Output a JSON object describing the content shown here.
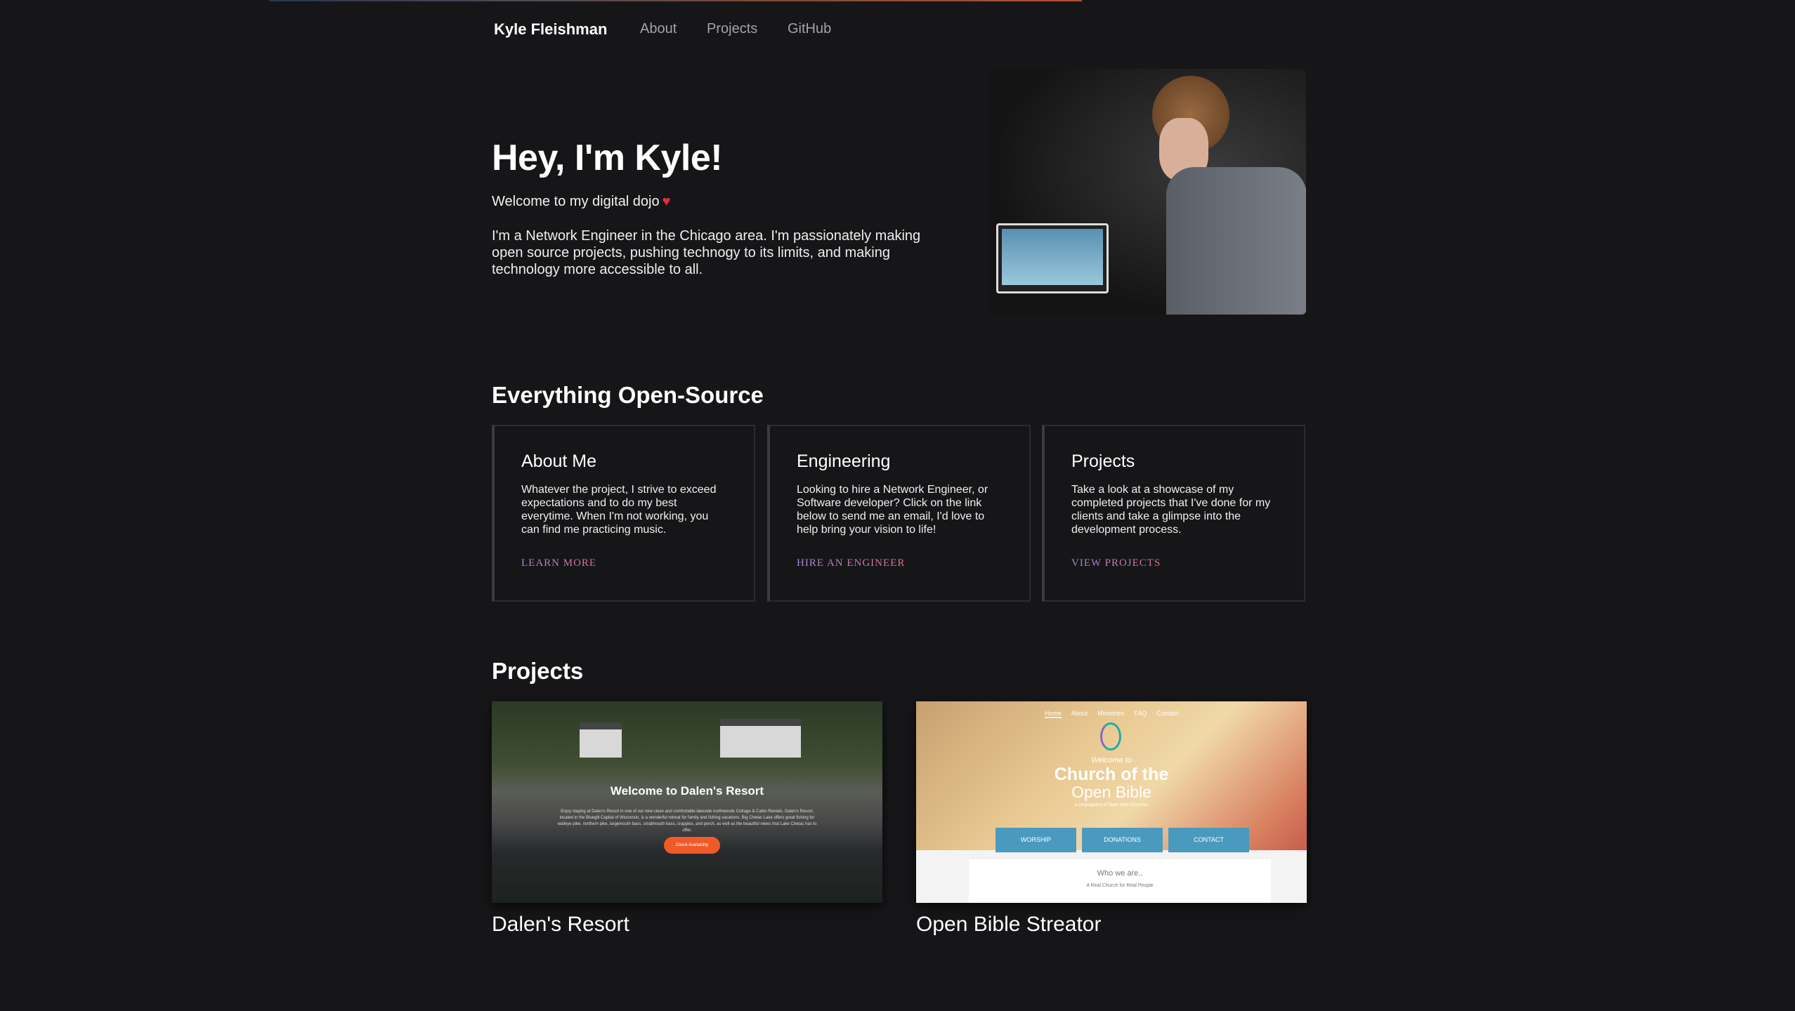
{
  "nav": {
    "brand": "Kyle Fleishman",
    "links": [
      "About",
      "Projects",
      "GitHub"
    ]
  },
  "hero": {
    "title": "Hey, I'm Kyle!",
    "welcome": "Welcome to my digital dojo",
    "heart": "♥",
    "intro": "I'm a Network Engineer in the Chicago area. I'm passionately making open source projects, pushing technogy to its limits, and making technology more accessible to all."
  },
  "open_source": {
    "heading": "Everything Open-Source",
    "cards": [
      {
        "title": "About Me",
        "text": "Whatever the project, I strive to exceed expectations and to do my best everytime. When I'm not working, you can find me practicing music.",
        "link": "LEARN MORE"
      },
      {
        "title": "Engineering",
        "text": "Looking to hire a Network Engineer, or Software developer? Click on the link below to send me an email, I'd love to help bring your vision to life!",
        "link": "HIRE AN ENGINEER"
      },
      {
        "title": "Projects",
        "text": "Take a look at a showcase of my completed projects that I've done for my clients and take a glimpse into the development process.",
        "link": "VIEW PROJECTS"
      }
    ]
  },
  "projects": {
    "heading": "Projects",
    "items": [
      {
        "caption": "Dalen's Resort",
        "shot": {
          "title": "Welcome to Dalen's Resort",
          "desc": "Enjoy staying at Dalen's Resort in one of our new clean and comfortable lakeside northwoods Cottage & Cabin Rentals. Dalen's Resort, located in the Bluegill Capital of Wisconsin, is a wonderful retreat for family and fishing vacations. Big Chetac Lake offers great fishing for walleye pike, northern pike, largemouth bass, smallmouth bass, crappies, and perch, as well as the beautiful views that Lake Chetac has to offer.",
          "button": "Check Availability"
        }
      },
      {
        "caption": "Open Bible Streator",
        "shot": {
          "nav": [
            "Home",
            "About",
            "Ministries",
            "FAQ",
            "Contact"
          ],
          "welcome": "Welcome to",
          "title1": "Church of the",
          "title2": "Open Bible",
          "sub": "a congregation of Open Bible Churches",
          "buttons": [
            "WORSHIP",
            "DONATIONS",
            "CONTACT"
          ],
          "who": "Who we are..",
          "tagline": "A Real Church for Real People"
        }
      }
    ]
  },
  "colors": {
    "background": "#161618",
    "heart": "#e0303c",
    "link_gradient_start": "#a48ae0",
    "link_gradient_end": "#e0708a"
  }
}
